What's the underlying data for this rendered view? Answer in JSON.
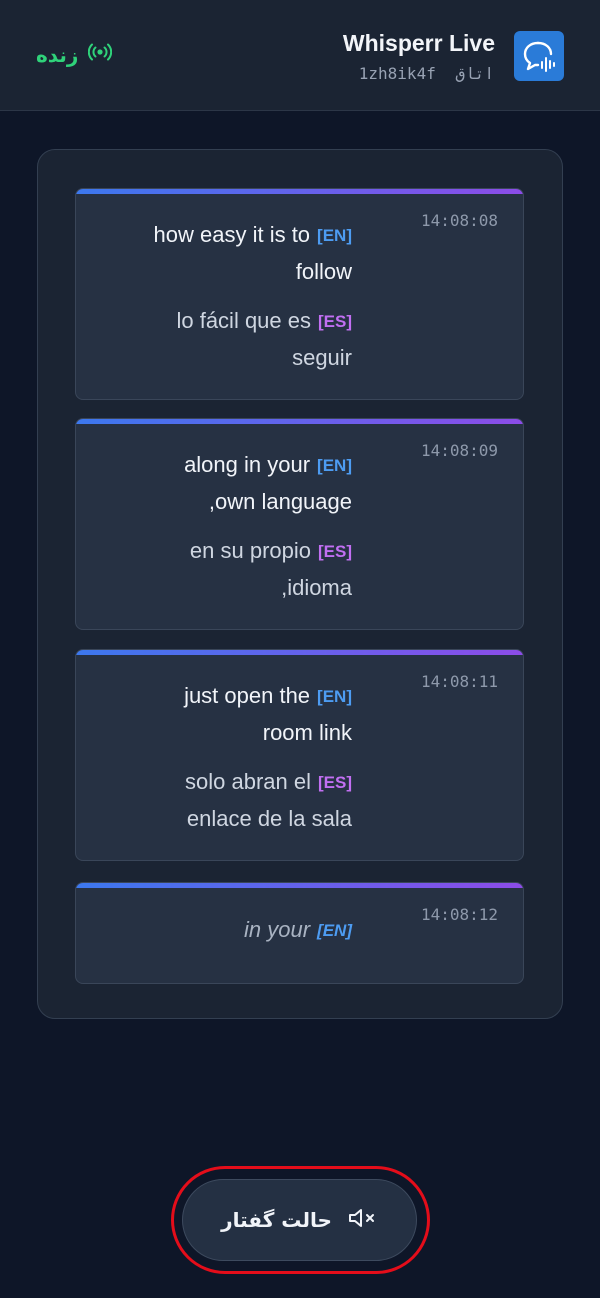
{
  "header": {
    "title": "Whisperr Live",
    "room_label": "اتاق",
    "room_id": "1zh8ik4f",
    "live_label": "زنده"
  },
  "messages": [
    {
      "time": "14:08:08",
      "original": {
        "lang": "[EN]",
        "line1": "how easy it is to",
        "line2": "follow"
      },
      "translation": {
        "lang": "[ES]",
        "line1": "lo fácil que es",
        "line2": "seguir"
      }
    },
    {
      "time": "14:08:09",
      "original": {
        "lang": "[EN]",
        "line1": "along in your",
        "line2": ",own language"
      },
      "translation": {
        "lang": "[ES]",
        "line1": "en su propio",
        "line2": ",idioma"
      }
    },
    {
      "time": "14:08:11",
      "original": {
        "lang": "[EN]",
        "line1": "just open the",
        "line2": "room link"
      },
      "translation": {
        "lang": "[ES]",
        "line1": "solo abran el",
        "line2": "enlace de la sala"
      }
    },
    {
      "time": "14:08:12",
      "original": {
        "lang": "[EN]",
        "line1": "in your",
        "line2": ""
      },
      "interim": true
    }
  ],
  "speak_button": {
    "label": "حالت گفتار",
    "icon": "speaker-muted-icon"
  },
  "colors": {
    "background": "#0e1628",
    "live": "#2fd27a",
    "en_tag": "#4d9cf2",
    "es_tag": "#c16ff2",
    "card_gradient": [
      "#3c78ee",
      "#8c4ce8"
    ],
    "highlight_ring": "#e40d1a"
  }
}
